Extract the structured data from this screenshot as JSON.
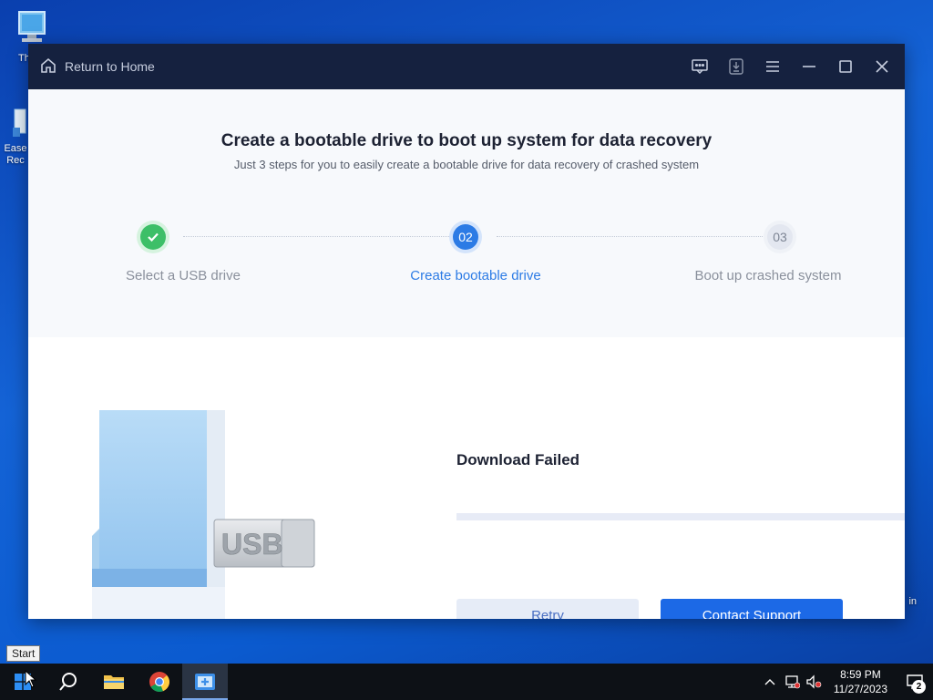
{
  "desktop": {
    "icons": [
      {
        "label": "Th"
      },
      {
        "label": "Ease Rec"
      }
    ],
    "edge_text": "in"
  },
  "window": {
    "home_label": "Return to Home",
    "title_icons": [
      "feedback-icon",
      "download-icon",
      "menu-icon",
      "minimize-icon",
      "maximize-icon",
      "close-icon"
    ]
  },
  "header": {
    "title": "Create a bootable drive to boot up system for data recovery",
    "subtitle": "Just 3 steps for you to easily create a bootable drive for data recovery of crashed system"
  },
  "steps": [
    {
      "number": "",
      "label": "Select a USB drive",
      "status": "done"
    },
    {
      "number": "02",
      "label": "Create bootable drive",
      "status": "active"
    },
    {
      "number": "03",
      "label": "Boot up crashed system",
      "status": "pending"
    }
  ],
  "illustration": {
    "usb_text": "USB"
  },
  "main": {
    "status_title": "Download Failed",
    "progress": 0,
    "retry_label": "Retry",
    "support_label": "Contact Support"
  },
  "taskbar": {
    "start_tooltip": "Start",
    "time": "8:59 PM",
    "date": "11/27/2023",
    "notification_count": "2"
  },
  "colors": {
    "accent": "#1c69e6",
    "done": "#3dbf68",
    "titlebar": "#15213f"
  }
}
